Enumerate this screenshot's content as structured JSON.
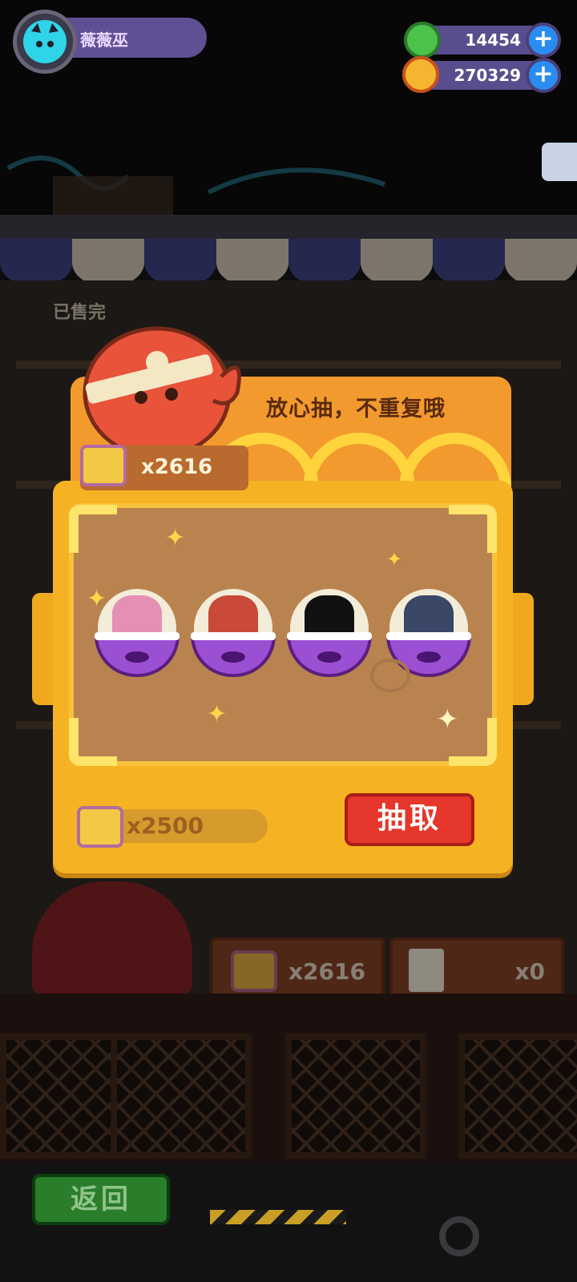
{
  "profile": {
    "username": "薇薇巫"
  },
  "currencies": [
    {
      "name": "gem",
      "value": "14454",
      "icon": "green-gem-icon",
      "color": "#4cc24a"
    },
    {
      "name": "gold",
      "value": "270329",
      "icon": "gold-coin-icon",
      "color": "#f6b531"
    }
  ],
  "background": {
    "soldout_label": "已售完",
    "crates": [
      {
        "count": "x2616"
      },
      {
        "count": "x0"
      }
    ]
  },
  "gacha_modal": {
    "banner_text": "放心抽，不重复哦",
    "owned_tickets": "x2616",
    "capsules": [
      {
        "character": "pink-hair-girl",
        "color": "#e58fb5"
      },
      {
        "character": "red-cap-boy",
        "color": "#c94a38"
      },
      {
        "character": "locked-silhouette",
        "color": "#111111"
      },
      {
        "character": "navy-hair-girl",
        "color": "#3a4767"
      }
    ],
    "cost": "x2500",
    "draw_label": "抽取"
  },
  "footer": {
    "back_label": "返回"
  }
}
